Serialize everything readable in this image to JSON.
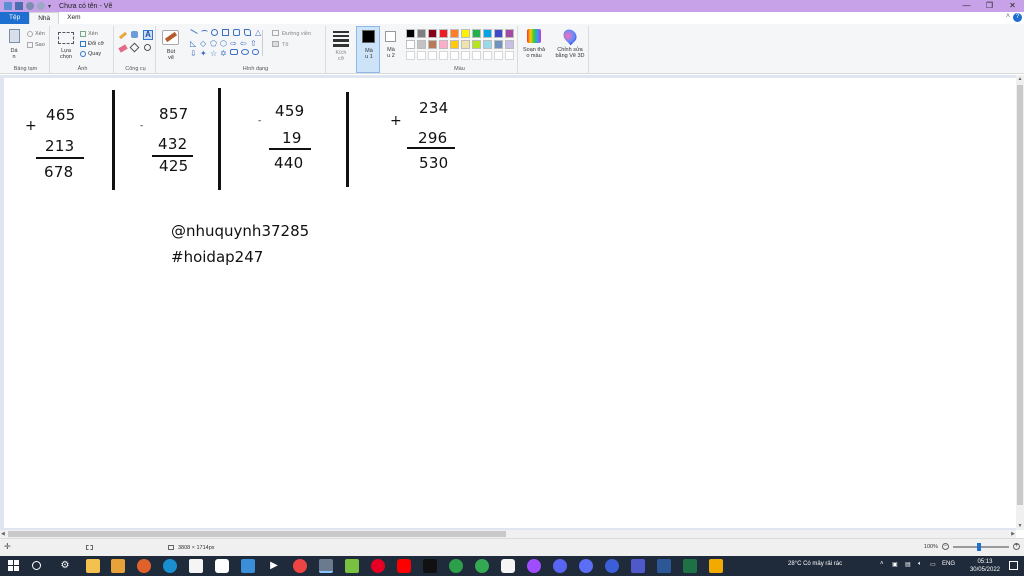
{
  "window": {
    "title": "Chưa có tên - Vẽ",
    "controls": {
      "minimize": "—",
      "restore": "❐",
      "close": "✕"
    }
  },
  "ribbon_tabs": [
    "Tệp",
    "Nhà",
    "Xem"
  ],
  "ribbon": {
    "clipboard": {
      "paste": "Dá\nn",
      "cut": "Xén",
      "copy": "Sao",
      "group_label": "Bảng tạm"
    },
    "image": {
      "select": "Lựa\nchọn",
      "crop": "Xén",
      "resize": "Đổi cỡ",
      "rotate": "Quay",
      "group_label": "Ảnh"
    },
    "tools": {
      "group_label": "Công cụ"
    },
    "brushes": {
      "label": "Bút\nvẽ"
    },
    "shapes": {
      "outline": "Đường viền",
      "fill": "Tô",
      "group_label": "Hình dạng"
    },
    "size": {
      "label": "Kích\ncỡ"
    },
    "color1": {
      "label": "Mà\nu 1"
    },
    "color2": {
      "label": "Mà\nu 2"
    },
    "colors": {
      "group_label": "Màu",
      "row1": [
        "#000000",
        "#7f7f7f",
        "#880015",
        "#ed1c24",
        "#ff7f27",
        "#fff200",
        "#22b14c",
        "#00a2e8",
        "#3f48cc",
        "#a349a4"
      ],
      "row2": [
        "#ffffff",
        "#c3c3c3",
        "#b97a57",
        "#ffaec9",
        "#ffc90e",
        "#efe4b0",
        "#b5e61d",
        "#99d9ea",
        "#7092be",
        "#c8bfe7"
      ]
    },
    "edit_colors": {
      "label": "Soạn thả\no màu"
    },
    "paint3d": {
      "label": "Chỉnh sửa\nbằng Vẽ 3D"
    }
  },
  "canvas": {
    "problems": [
      {
        "operator": "+",
        "top": "465",
        "bottom": "213",
        "result": "678"
      },
      {
        "operator": "-",
        "top": "857",
        "bottom": "432",
        "result": "425"
      },
      {
        "operator": "-",
        "top": "459",
        "bottom": "19",
        "result": "440"
      },
      {
        "operator": "+",
        "top": "234",
        "bottom": "296",
        "result": "530"
      }
    ],
    "signature": [
      "@nhuquynh37285",
      "#hoidap247"
    ]
  },
  "status": {
    "dimensions": "3808 × 1714px",
    "zoom": "100%"
  },
  "taskbar": {
    "weather": "28°C  Có mây rải rác",
    "language": "ENG",
    "time": "05:13",
    "date": "30/05/2022"
  }
}
